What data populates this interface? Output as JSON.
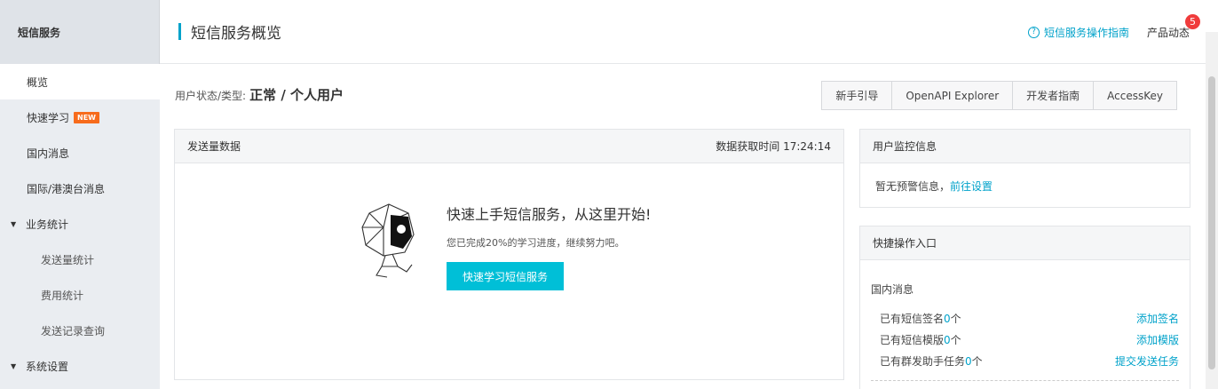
{
  "sidebar": {
    "title": "短信服务",
    "items": [
      {
        "label": "概览",
        "type": "item",
        "active": true
      },
      {
        "label": "快速学习",
        "type": "item",
        "badge": "NEW"
      },
      {
        "label": "国内消息",
        "type": "item"
      },
      {
        "label": "国际/港澳台消息",
        "type": "item"
      },
      {
        "label": "业务统计",
        "type": "group"
      },
      {
        "label": "发送量统计",
        "type": "sub"
      },
      {
        "label": "费用统计",
        "type": "sub"
      },
      {
        "label": "发送记录查询",
        "type": "sub"
      },
      {
        "label": "系统设置",
        "type": "group"
      }
    ]
  },
  "header": {
    "title": "短信服务概览",
    "guide_icon": "help-circle-icon",
    "guide_link": "短信服务操作指南",
    "product_news": "产品动态",
    "news_count": "5"
  },
  "status": {
    "label": "用户状态/类型:",
    "value": "正常 / 个人用户"
  },
  "buttons": {
    "beginner": "新手引导",
    "openapi": "OpenAPI Explorer",
    "devguide": "开发者指南",
    "accesskey": "AccessKey"
  },
  "send_panel": {
    "title": "发送量数据",
    "fetch_time": "数据获取时间 17:24:14",
    "promo_title": "快速上手短信服务，从这里开始!",
    "promo_sub": "您已完成20%的学习进度，继续努力吧。",
    "promo_button": "快速学习短信服务",
    "robot_icon": "robot-illustration"
  },
  "monitor_panel": {
    "title": "用户监控信息",
    "text": "暂无预警信息，",
    "link": "前往设置"
  },
  "quick_panel": {
    "title": "快捷操作入口",
    "section": "国内消息",
    "rows": [
      {
        "prefix": "已有短信签名",
        "count": "0",
        "suffix": "个",
        "action": "添加签名"
      },
      {
        "prefix": "已有短信模版",
        "count": "0",
        "suffix": "个",
        "action": "添加模版"
      },
      {
        "prefix": "已有群发助手任务",
        "count": "0",
        "suffix": "个",
        "action": "提交发送任务"
      }
    ]
  },
  "colors": {
    "accent": "#00a2ca",
    "primary_button": "#00bfd7",
    "new_badge": "#f76b1c",
    "count_badge": "#f03c3c"
  }
}
